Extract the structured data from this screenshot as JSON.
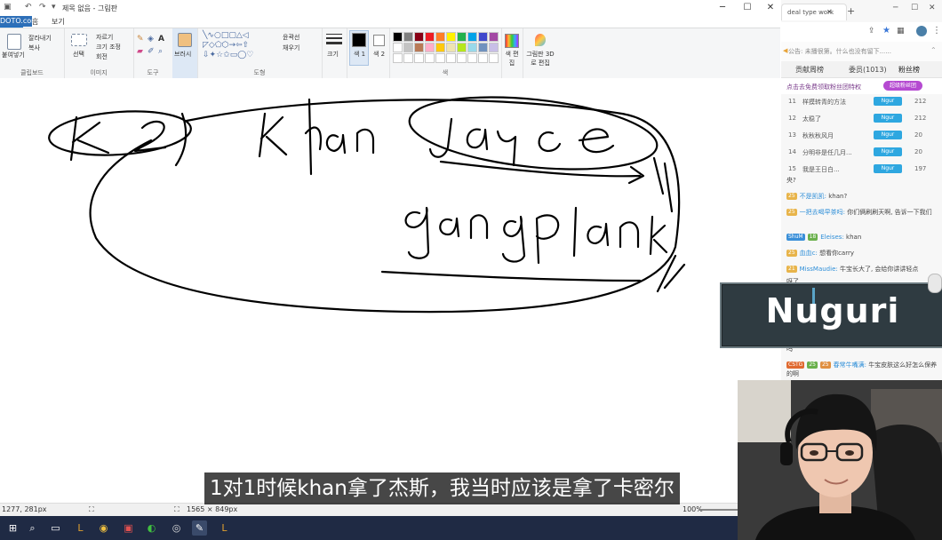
{
  "watermark": "DOTO.com",
  "paint": {
    "title": "제목 없음 - 그림판",
    "tabs": [
      "파일",
      "홈",
      "보기"
    ],
    "groups": {
      "clipboard": {
        "label": "클립보드",
        "paste": "붙여넣기",
        "cut": "잘라내기",
        "copy": "복사"
      },
      "image": {
        "label": "이미지",
        "select": "선택",
        "crop": "자르기",
        "resize": "크기 조정",
        "rotate": "회전"
      },
      "tools": {
        "label": "도구"
      },
      "brushes": {
        "label": "브러시"
      },
      "shapes": {
        "label": "도형",
        "outline": "윤곽선",
        "fill": "채우기"
      },
      "size": {
        "label": "크기"
      },
      "color1": {
        "label": "색 1"
      },
      "color2": {
        "label": "색 2"
      },
      "colors": {
        "label": "색"
      },
      "edit_colors": {
        "label": "색 편집"
      },
      "paint3d": {
        "label": "그림판 3D로 편집"
      }
    },
    "palette": [
      "#000000",
      "#7f7f7f",
      "#880015",
      "#ed1c24",
      "#ff7f27",
      "#fff200",
      "#22b14c",
      "#00a2e8",
      "#3f48cc",
      "#a349a4",
      "#ffffff",
      "#c3c3c3",
      "#b97a57",
      "#ffaec9",
      "#ffc90e",
      "#efe4b0",
      "#b5e61d",
      "#99d9ea",
      "#7092be",
      "#c8bfe7",
      "#ffffff",
      "#ffffff",
      "#ffffff",
      "#ffffff",
      "#ffffff",
      "#ffffff",
      "#ffffff",
      "#ffffff",
      "#ffffff",
      "#ffffff"
    ],
    "status": {
      "cursor": "1277, 281px",
      "canvas_size": "1565 × 849px",
      "zoom": "100%"
    }
  },
  "browser": {
    "tab_title": "deal type work",
    "notice": "公告: 未播很第。什么也没有留下......",
    "chat_tabs": [
      "贡献周榜",
      "委员(1013)",
      "粉丝榜"
    ],
    "fan_text": "点击去免费领取粉丝团特权",
    "fan_badge": "超级粉丝团",
    "ranks": [
      {
        "n": "11",
        "name": "样摸转青的方法",
        "badge": "Ngur",
        "score": "212"
      },
      {
        "n": "12",
        "name": "太稳了",
        "badge": "Ngur",
        "score": "212"
      },
      {
        "n": "13",
        "name": "秋秋秋风月",
        "badge": "Ngur",
        "score": "20"
      },
      {
        "n": "14",
        "name": "分明非是任几月...",
        "badge": "Ngur",
        "score": "20"
      },
      {
        "n": "15",
        "name": "我是王日白...",
        "badge": "Ngur",
        "score": "197"
      }
    ],
    "messages": [
      {
        "tags": [],
        "user": "",
        "text": "央?"
      },
      {
        "tags": [
          "25"
        ],
        "user": "不是凯凯:",
        "text": "khan?"
      },
      {
        "tags": [
          "25"
        ],
        "user": "一把去喝早茶吗:",
        "text": "你们俩刷刷天啊, 告诉一下我们"
      },
      {
        "tags": [
          "ShuM",
          "18"
        ],
        "user": "Eleises:",
        "text": "khan"
      },
      {
        "tags": [
          "25"
        ],
        "user": "血血c:",
        "text": "想看你carry"
      },
      {
        "tags": [
          "21"
        ],
        "user": "MissMaudie:",
        "text": "牛宝长大了, 会给你讲讲轻点"
      },
      {
        "tags": [],
        "user": "",
        "text": "呀了"
      },
      {
        "tags": [],
        "user": "",
        "text": "吗"
      },
      {
        "tags": [
          "CSTG",
          "25",
          "25"
        ],
        "user": "春常牛嘴满:",
        "text": "牛宝皮肤这么好怎么保养的啊"
      }
    ]
  },
  "overlay": {
    "player_name": "Nuguri"
  },
  "subtitle": "1对1时候khan拿了杰斯，我当时应该是拿了卡密尔",
  "drawing_words": [
    "K2",
    "Khan",
    "Jayce",
    "Gangplank"
  ]
}
